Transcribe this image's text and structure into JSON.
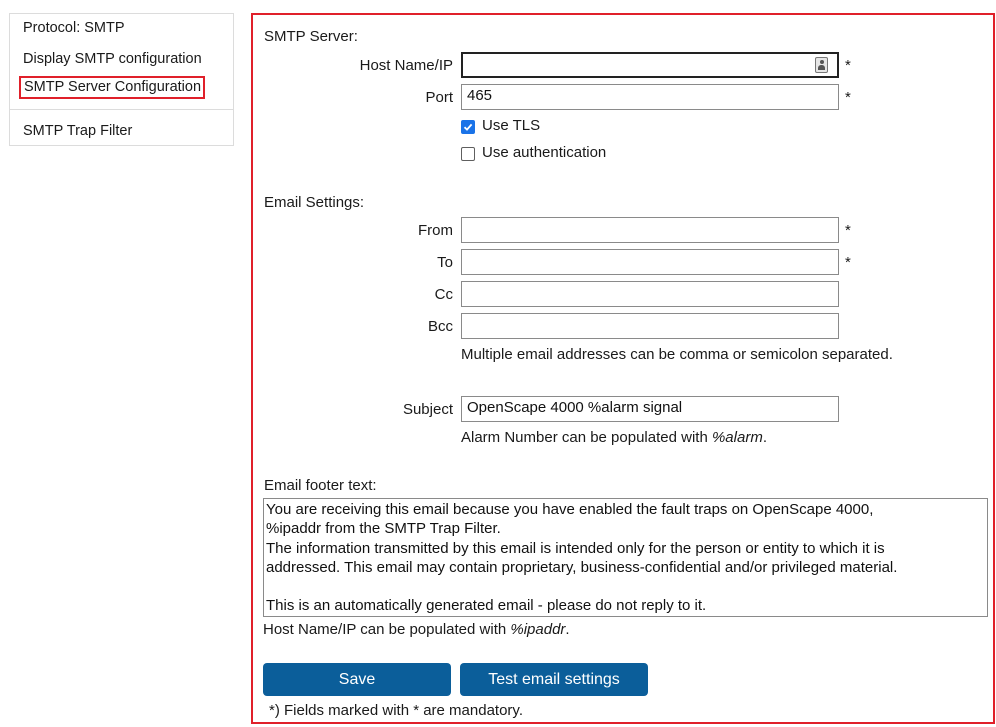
{
  "sidebar": {
    "items": [
      {
        "label": "Protocol: SMTP"
      },
      {
        "label": "Display SMTP configuration"
      },
      {
        "label": "SMTP Server Configuration",
        "active": true
      },
      {
        "label": "SMTP Trap Filter"
      }
    ]
  },
  "smtp_server": {
    "heading": "SMTP Server:",
    "host_label": "Host Name/IP",
    "host_value": "",
    "port_label": "Port",
    "port_value": "465",
    "required_mark": "*",
    "use_tls": {
      "label": "Use TLS",
      "checked": true
    },
    "use_auth": {
      "label": "Use authentication",
      "checked": false
    }
  },
  "email_settings": {
    "heading": "Email Settings:",
    "from_label": "From",
    "from_value": "",
    "to_label": "To",
    "to_value": "",
    "cc_label": "Cc",
    "cc_value": "",
    "bcc_label": "Bcc",
    "bcc_value": "",
    "addresses_hint": "Multiple email addresses can be comma or semicolon separated.",
    "subject_label": "Subject",
    "subject_value": "OpenScape 4000 %alarm signal",
    "alarm_hint_prefix": "Alarm Number can be populated with ",
    "alarm_hint_var": "%alarm",
    "alarm_hint_suffix": "."
  },
  "footer": {
    "heading": "Email footer text:",
    "text": "You are receiving this email because you have enabled the fault traps on OpenScape 4000,\n%ipaddr from the SMTP Trap Filter.\nThe information transmitted by this email is intended only for the person or entity to which it is\naddressed. This email may contain proprietary, business-confidential and/or privileged material.\n\nThis is an automatically generated email - please do not reply to it.",
    "hint_prefix": "Host Name/IP can be populated with ",
    "hint_var": "%ipaddr",
    "hint_suffix": "."
  },
  "buttons": {
    "save": "Save",
    "test": "Test email settings"
  },
  "mandatory_note": "*) Fields marked with * are mandatory.",
  "icons": {
    "host_field": "contact-card-icon",
    "checkbox": "checkmark-icon"
  },
  "colors": {
    "accent_red": "#e0202a",
    "button_blue": "#0b5e9a",
    "checkbox_blue": "#1a73e8"
  }
}
